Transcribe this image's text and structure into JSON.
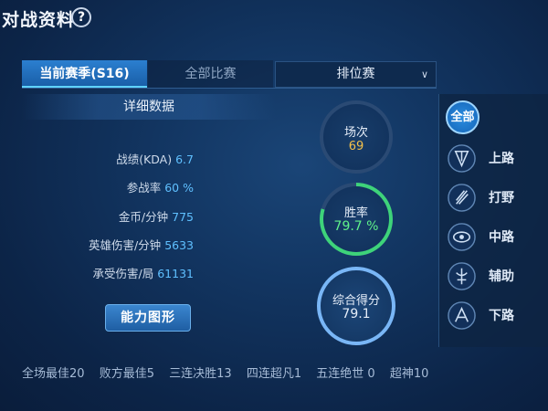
{
  "header": {
    "title": "对战资料",
    "help_icon": "?"
  },
  "tabs": [
    {
      "label": "当前赛季(S16)",
      "active": true
    },
    {
      "label": "全部比赛",
      "active": false
    }
  ],
  "mode_select": {
    "value": "排位赛"
  },
  "detail": {
    "title": "详细数据",
    "stats": [
      {
        "label": "战绩(KDA)",
        "value": "6.7"
      },
      {
        "label": "参战率",
        "value": "60 %"
      },
      {
        "label": "金币/分钟",
        "value": "775"
      },
      {
        "label": "英雄伤害/分钟",
        "value": "5633"
      },
      {
        "label": "承受伤害/局",
        "value": "61131"
      }
    ],
    "ability_button": "能力图形"
  },
  "summary": {
    "games": {
      "label": "场次",
      "value": "69"
    },
    "winrate": {
      "label": "胜率",
      "value": "79.7 %",
      "fraction": 0.797
    },
    "score": {
      "label": "综合得分",
      "value": "79.1"
    }
  },
  "roles": [
    {
      "label": "全部",
      "icon": "all-badge",
      "selected": true
    },
    {
      "label": "上路",
      "icon": "top-lane-icon"
    },
    {
      "label": "打野",
      "icon": "jungle-icon"
    },
    {
      "label": "中路",
      "icon": "mid-lane-icon"
    },
    {
      "label": "辅助",
      "icon": "support-icon"
    },
    {
      "label": "下路",
      "icon": "bot-lane-icon"
    }
  ],
  "honors": [
    {
      "label": "全场最佳",
      "value": "20"
    },
    {
      "label": "败方最佳",
      "value": "5"
    },
    {
      "label": "三连决胜",
      "value": "13"
    },
    {
      "label": "四连超凡",
      "value": "1"
    },
    {
      "label": "五连绝世 ",
      "value": "0"
    },
    {
      "label": "超神",
      "value": "10"
    }
  ],
  "colors": {
    "stat_value": "#5fc0ff",
    "games_value": "#f3c04a",
    "winrate_ring": "#3ed37a",
    "winrate_value": "#5ff28a",
    "score_ring": "#79b6f6"
  }
}
